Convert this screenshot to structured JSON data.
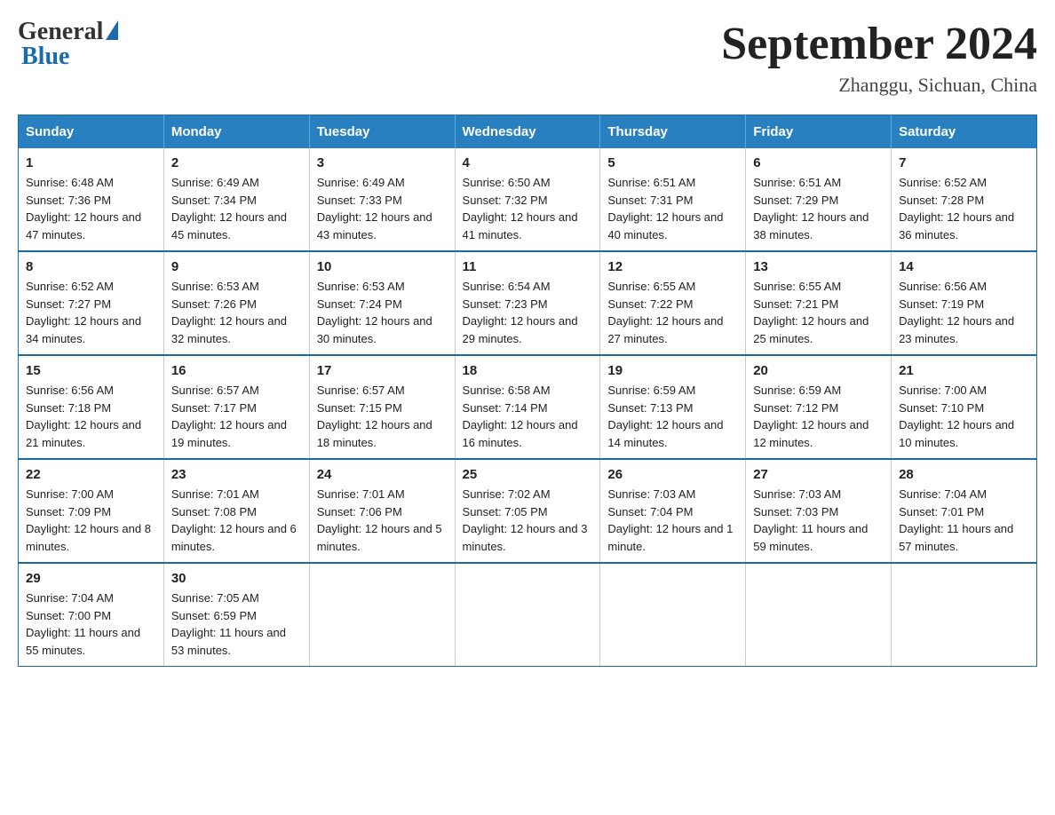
{
  "header": {
    "logo": {
      "general": "General",
      "blue": "Blue"
    },
    "title": "September 2024",
    "subtitle": "Zhanggu, Sichuan, China"
  },
  "calendar": {
    "days_of_week": [
      "Sunday",
      "Monday",
      "Tuesday",
      "Wednesday",
      "Thursday",
      "Friday",
      "Saturday"
    ],
    "weeks": [
      [
        {
          "day": "1",
          "sunrise": "6:48 AM",
          "sunset": "7:36 PM",
          "daylight": "12 hours and 47 minutes."
        },
        {
          "day": "2",
          "sunrise": "6:49 AM",
          "sunset": "7:34 PM",
          "daylight": "12 hours and 45 minutes."
        },
        {
          "day": "3",
          "sunrise": "6:49 AM",
          "sunset": "7:33 PM",
          "daylight": "12 hours and 43 minutes."
        },
        {
          "day": "4",
          "sunrise": "6:50 AM",
          "sunset": "7:32 PM",
          "daylight": "12 hours and 41 minutes."
        },
        {
          "day": "5",
          "sunrise": "6:51 AM",
          "sunset": "7:31 PM",
          "daylight": "12 hours and 40 minutes."
        },
        {
          "day": "6",
          "sunrise": "6:51 AM",
          "sunset": "7:29 PM",
          "daylight": "12 hours and 38 minutes."
        },
        {
          "day": "7",
          "sunrise": "6:52 AM",
          "sunset": "7:28 PM",
          "daylight": "12 hours and 36 minutes."
        }
      ],
      [
        {
          "day": "8",
          "sunrise": "6:52 AM",
          "sunset": "7:27 PM",
          "daylight": "12 hours and 34 minutes."
        },
        {
          "day": "9",
          "sunrise": "6:53 AM",
          "sunset": "7:26 PM",
          "daylight": "12 hours and 32 minutes."
        },
        {
          "day": "10",
          "sunrise": "6:53 AM",
          "sunset": "7:24 PM",
          "daylight": "12 hours and 30 minutes."
        },
        {
          "day": "11",
          "sunrise": "6:54 AM",
          "sunset": "7:23 PM",
          "daylight": "12 hours and 29 minutes."
        },
        {
          "day": "12",
          "sunrise": "6:55 AM",
          "sunset": "7:22 PM",
          "daylight": "12 hours and 27 minutes."
        },
        {
          "day": "13",
          "sunrise": "6:55 AM",
          "sunset": "7:21 PM",
          "daylight": "12 hours and 25 minutes."
        },
        {
          "day": "14",
          "sunrise": "6:56 AM",
          "sunset": "7:19 PM",
          "daylight": "12 hours and 23 minutes."
        }
      ],
      [
        {
          "day": "15",
          "sunrise": "6:56 AM",
          "sunset": "7:18 PM",
          "daylight": "12 hours and 21 minutes."
        },
        {
          "day": "16",
          "sunrise": "6:57 AM",
          "sunset": "7:17 PM",
          "daylight": "12 hours and 19 minutes."
        },
        {
          "day": "17",
          "sunrise": "6:57 AM",
          "sunset": "7:15 PM",
          "daylight": "12 hours and 18 minutes."
        },
        {
          "day": "18",
          "sunrise": "6:58 AM",
          "sunset": "7:14 PM",
          "daylight": "12 hours and 16 minutes."
        },
        {
          "day": "19",
          "sunrise": "6:59 AM",
          "sunset": "7:13 PM",
          "daylight": "12 hours and 14 minutes."
        },
        {
          "day": "20",
          "sunrise": "6:59 AM",
          "sunset": "7:12 PM",
          "daylight": "12 hours and 12 minutes."
        },
        {
          "day": "21",
          "sunrise": "7:00 AM",
          "sunset": "7:10 PM",
          "daylight": "12 hours and 10 minutes."
        }
      ],
      [
        {
          "day": "22",
          "sunrise": "7:00 AM",
          "sunset": "7:09 PM",
          "daylight": "12 hours and 8 minutes."
        },
        {
          "day": "23",
          "sunrise": "7:01 AM",
          "sunset": "7:08 PM",
          "daylight": "12 hours and 6 minutes."
        },
        {
          "day": "24",
          "sunrise": "7:01 AM",
          "sunset": "7:06 PM",
          "daylight": "12 hours and 5 minutes."
        },
        {
          "day": "25",
          "sunrise": "7:02 AM",
          "sunset": "7:05 PM",
          "daylight": "12 hours and 3 minutes."
        },
        {
          "day": "26",
          "sunrise": "7:03 AM",
          "sunset": "7:04 PM",
          "daylight": "12 hours and 1 minute."
        },
        {
          "day": "27",
          "sunrise": "7:03 AM",
          "sunset": "7:03 PM",
          "daylight": "11 hours and 59 minutes."
        },
        {
          "day": "28",
          "sunrise": "7:04 AM",
          "sunset": "7:01 PM",
          "daylight": "11 hours and 57 minutes."
        }
      ],
      [
        {
          "day": "29",
          "sunrise": "7:04 AM",
          "sunset": "7:00 PM",
          "daylight": "11 hours and 55 minutes."
        },
        {
          "day": "30",
          "sunrise": "7:05 AM",
          "sunset": "6:59 PM",
          "daylight": "11 hours and 53 minutes."
        },
        null,
        null,
        null,
        null,
        null
      ]
    ]
  }
}
